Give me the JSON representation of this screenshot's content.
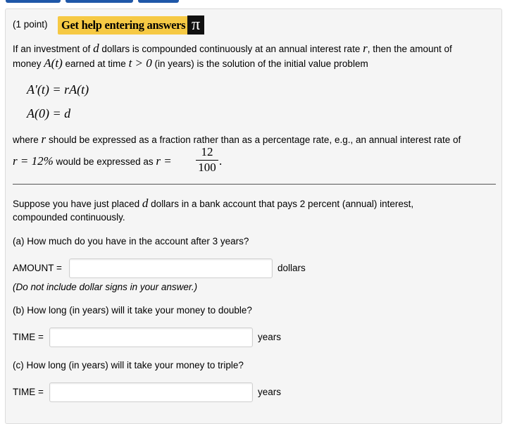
{
  "header": {
    "points": "(1 point)",
    "help_label": "Get help entering answers",
    "pi_symbol": "π"
  },
  "intro": {
    "line1_a": "If an investment of",
    "line1_var_d": "d",
    "line1_b": "dollars is compounded continuously at an annual interest rate",
    "line1_var_r": "r",
    "line1_c": ", then the amount of",
    "line2_a": "money",
    "line2_math_A": "A(t)",
    "line2_b": "earned at time",
    "line2_math_t": "t > 0",
    "line2_c": "(in years) is the solution of the initial value problem"
  },
  "equations": {
    "ode": "A′(t) = rA(t)",
    "initial": "A(0) = d"
  },
  "note": {
    "line1": "where",
    "var_r": "r",
    "line1_b": "should be expressed as a fraction rather than as a percentage rate, e.g., an annual interest rate of",
    "example_rate": "r = 12%",
    "line2_b": "would be expressed as",
    "example_r": "r =",
    "numerator": "12",
    "denominator": "100",
    "period": "."
  },
  "problem": {
    "line1_a": "Suppose you have just placed",
    "var_d": "d",
    "line1_b": "dollars in a bank account that pays 2 percent (annual) interest,",
    "line2": "compounded continuously."
  },
  "parts": {
    "a": {
      "question": "(a) How much do you have in the account after 3 years?",
      "label": "AMOUNT =",
      "value": "",
      "unit": "dollars",
      "hint": "(Do not include dollar signs in your answer.)"
    },
    "b": {
      "question": "(b) How long (in years) will it take your money to double?",
      "label": "TIME =",
      "value": "",
      "unit": "years"
    },
    "c": {
      "question": "(c) How long (in years) will it take your money to triple?",
      "label": "TIME =",
      "value": "",
      "unit": "years"
    }
  }
}
